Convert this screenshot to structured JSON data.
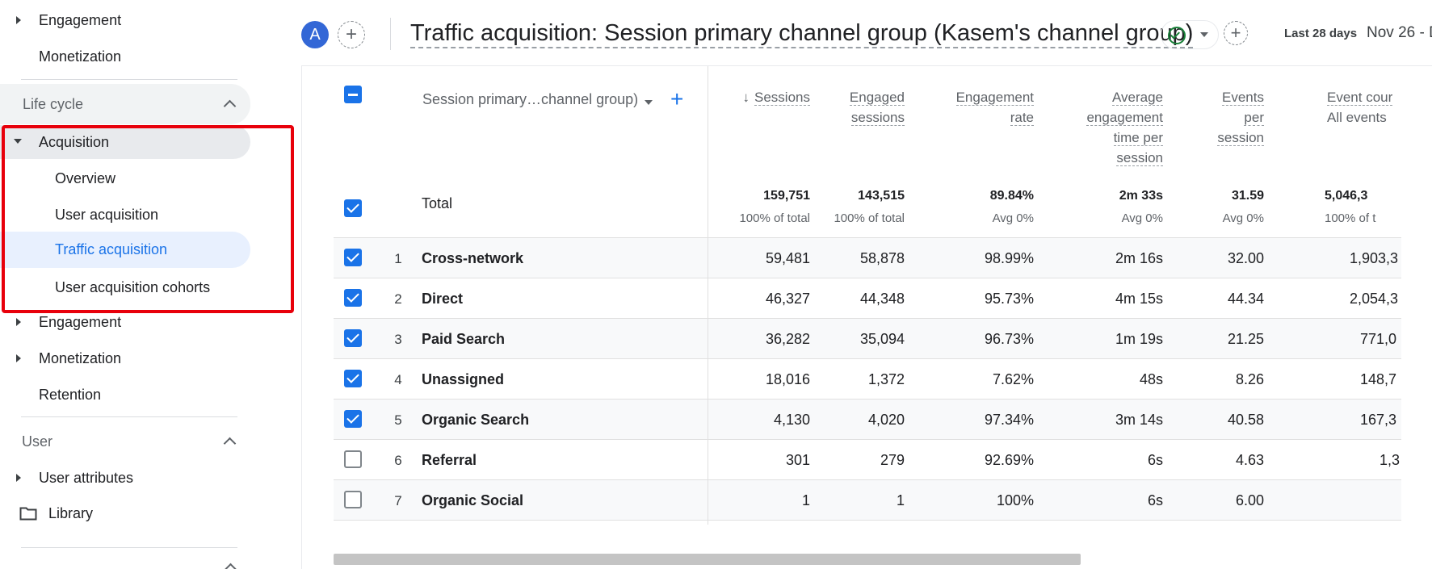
{
  "sidebar": {
    "top_items": [
      {
        "label": "Engagement",
        "expandable": true
      },
      {
        "label": "Monetization",
        "expandable": false
      }
    ],
    "lifecycle": {
      "header": "Life cycle",
      "acquisition": {
        "label": "Acquisition",
        "children": [
          "Overview",
          "User acquisition",
          "Traffic acquisition",
          "User acquisition cohorts"
        ],
        "selected": "Traffic acquisition"
      },
      "items": [
        {
          "label": "Engagement",
          "expandable": true
        },
        {
          "label": "Monetization",
          "expandable": true
        },
        {
          "label": "Retention",
          "expandable": false
        }
      ]
    },
    "user": {
      "header": "User",
      "items": [
        {
          "label": "User attributes",
          "expandable": true
        }
      ]
    },
    "library": {
      "label": "Library",
      "icon": "folder-icon"
    }
  },
  "header": {
    "avatar_letter": "A",
    "title": "Traffic acquisition: Session primary channel group (Kasem's channel group)",
    "date_chip": "Last 28 days",
    "date_range": "Nov 26 - D"
  },
  "table": {
    "dimension_header": "Session primary…channel group)",
    "columns": [
      {
        "label_lines": [
          "Sessions"
        ],
        "sorted": true
      },
      {
        "label_lines": [
          "Engaged",
          "sessions"
        ]
      },
      {
        "label_lines": [
          "Engagement",
          "rate"
        ]
      },
      {
        "label_lines": [
          "Average",
          "engagement",
          "time per",
          "session"
        ]
      },
      {
        "label_lines": [
          "Events",
          "per",
          "session"
        ]
      },
      {
        "label_lines": [
          "Event cour"
        ],
        "sub": "All events"
      }
    ],
    "total": {
      "label": "Total",
      "values": [
        "159,751",
        "143,515",
        "89.84%",
        "2m 33s",
        "31.59",
        "5,046,3"
      ],
      "subs": [
        "100% of total",
        "100% of total",
        "Avg 0%",
        "Avg 0%",
        "Avg 0%",
        "100% of t"
      ]
    },
    "rows": [
      {
        "rank": "1",
        "name": "Cross-network",
        "checked": true,
        "values": [
          "59,481",
          "58,878",
          "98.99%",
          "2m 16s",
          "32.00",
          "1,903,3"
        ]
      },
      {
        "rank": "2",
        "name": "Direct",
        "checked": true,
        "values": [
          "46,327",
          "44,348",
          "95.73%",
          "4m 15s",
          "44.34",
          "2,054,3"
        ]
      },
      {
        "rank": "3",
        "name": "Paid Search",
        "checked": true,
        "values": [
          "36,282",
          "35,094",
          "96.73%",
          "1m 19s",
          "21.25",
          "771,0"
        ]
      },
      {
        "rank": "4",
        "name": "Unassigned",
        "checked": true,
        "values": [
          "18,016",
          "1,372",
          "7.62%",
          "48s",
          "8.26",
          "148,7"
        ]
      },
      {
        "rank": "5",
        "name": "Organic Search",
        "checked": true,
        "values": [
          "4,130",
          "4,020",
          "97.34%",
          "3m 14s",
          "40.58",
          "167,3"
        ]
      },
      {
        "rank": "6",
        "name": "Referral",
        "checked": false,
        "values": [
          "301",
          "279",
          "92.69%",
          "6s",
          "4.63",
          "1,3"
        ]
      },
      {
        "rank": "7",
        "name": "Organic Social",
        "checked": false,
        "values": [
          "1",
          "1",
          "100%",
          "6s",
          "6.00",
          ""
        ]
      }
    ]
  },
  "colors": {
    "accent": "#1a73e8",
    "highlight": "#e8000b",
    "selected_bg": "#e8f0fe"
  }
}
